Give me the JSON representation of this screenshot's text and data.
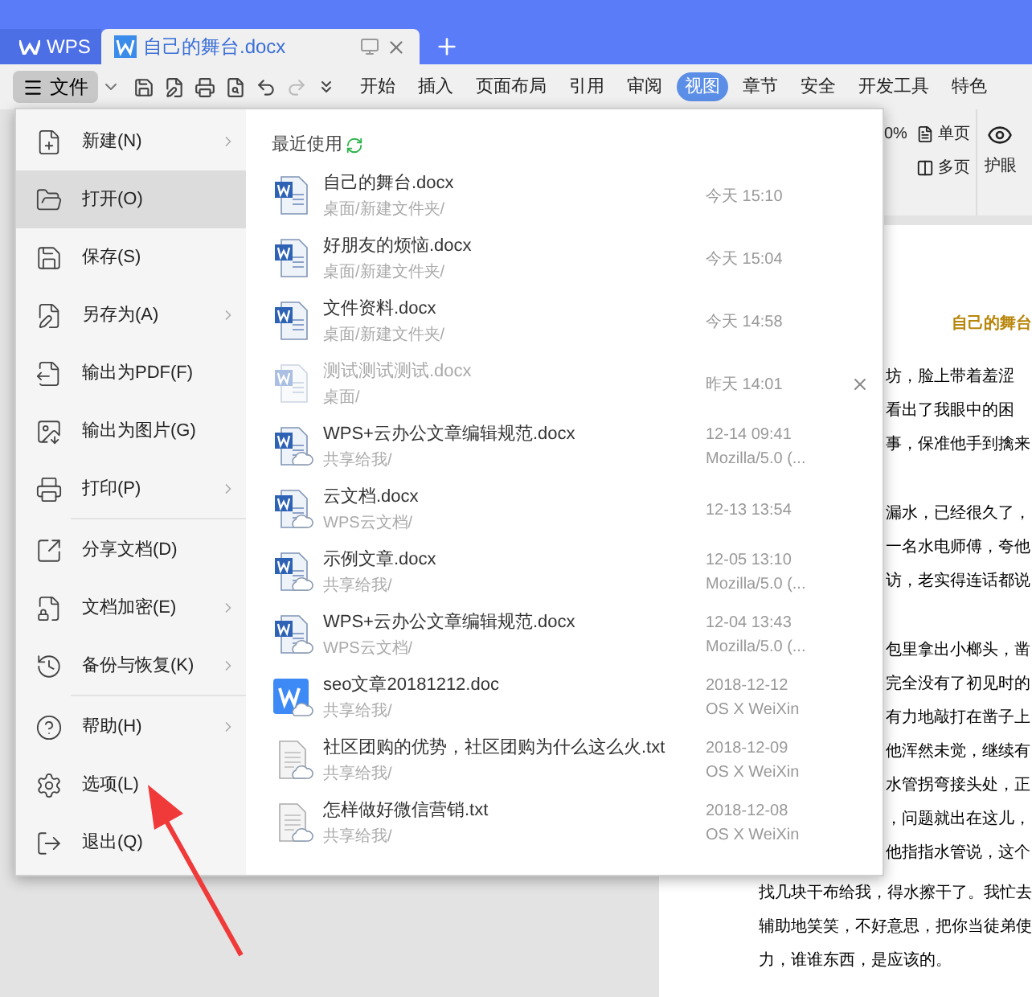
{
  "title_bar": {
    "app_tab": "WPS",
    "doc_tab": "自己的舞台.docx"
  },
  "toolbar": {
    "file_menu": "文件",
    "tabs": [
      {
        "label": "开始",
        "selected": false
      },
      {
        "label": "插入",
        "selected": false
      },
      {
        "label": "页面布局",
        "selected": false
      },
      {
        "label": "引用",
        "selected": false
      },
      {
        "label": "审阅",
        "selected": false
      },
      {
        "label": "视图",
        "selected": true
      },
      {
        "label": "章节",
        "selected": false
      },
      {
        "label": "安全",
        "selected": false
      },
      {
        "label": "开发工具",
        "selected": false
      },
      {
        "label": "特色",
        "selected": false
      }
    ]
  },
  "ribbon": {
    "zoom": "0%",
    "single_page": "单页",
    "multi_page": "多页",
    "eye_mode": "护眼"
  },
  "file_menu": {
    "groups": [
      [
        {
          "label": "新建(N)",
          "submenu": true,
          "selected": false
        },
        {
          "label": "打开(O)",
          "submenu": false,
          "selected": true
        },
        {
          "label": "保存(S)",
          "submenu": false,
          "selected": false
        },
        {
          "label": "另存为(A)",
          "submenu": true,
          "selected": false
        },
        {
          "label": "输出为PDF(F)",
          "submenu": false,
          "selected": false
        },
        {
          "label": "输出为图片(G)",
          "submenu": false,
          "selected": false
        },
        {
          "label": "打印(P)",
          "submenu": true,
          "selected": false
        }
      ],
      [
        {
          "label": "分享文档(D)",
          "submenu": false,
          "selected": false
        },
        {
          "label": "文档加密(E)",
          "submenu": true,
          "selected": false
        },
        {
          "label": "备份与恢复(K)",
          "submenu": true,
          "selected": false
        }
      ],
      [
        {
          "label": "帮助(H)",
          "submenu": true,
          "selected": false
        },
        {
          "label": "选项(L)",
          "submenu": false,
          "selected": false
        },
        {
          "label": "退出(Q)",
          "submenu": false,
          "selected": false
        }
      ]
    ]
  },
  "recent": {
    "heading": "最近使用",
    "files": [
      {
        "kind": "word",
        "name": "自己的舞台.docx",
        "path": "桌面/新建文件夹/",
        "time": "今天 15:10",
        "unavailable": false,
        "removable": false
      },
      {
        "kind": "word",
        "name": "好朋友的烦恼.docx",
        "path": "桌面/新建文件夹/",
        "time": "今天 15:04",
        "unavailable": false,
        "removable": false
      },
      {
        "kind": "word",
        "name": "文件资料.docx",
        "path": "桌面/新建文件夹/",
        "time": "今天 14:58",
        "unavailable": false,
        "removable": false
      },
      {
        "kind": "word",
        "name": "测试测试测试.docx",
        "path": "桌面/",
        "time": "昨天 14:01",
        "unavailable": true,
        "removable": true
      },
      {
        "kind": "word-cloud",
        "name": "WPS+云办公文章编辑规范.docx",
        "path": "共享给我/",
        "time": "12-14 09:41",
        "source": "Mozilla/5.0 (...",
        "unavailable": false,
        "removable": false
      },
      {
        "kind": "word-cloud",
        "name": "云文档.docx",
        "path": "WPS云文档/",
        "time": "12-13 13:54",
        "unavailable": false,
        "removable": false
      },
      {
        "kind": "word-cloud",
        "name": "示例文章.docx",
        "path": "共享给我/",
        "time": "12-05 13:10",
        "source": "Mozilla/5.0 (...",
        "unavailable": false,
        "removable": false
      },
      {
        "kind": "word-cloud",
        "name": "WPS+云办公文章编辑规范.docx",
        "path": "WPS云文档/",
        "time": "12-04 13:43",
        "source": "Mozilla/5.0 (...",
        "unavailable": false,
        "removable": false
      },
      {
        "kind": "wps-cloud",
        "name": "seo文章20181212.doc",
        "path": "共享给我/",
        "time": "2018-12-12",
        "source": "OS X WeiXin",
        "unavailable": false,
        "removable": false
      },
      {
        "kind": "text-cloud",
        "name": "社区团购的优势，社区团购为什么这么火.txt",
        "path": "共享给我/",
        "time": "2018-12-09",
        "source": "OS X WeiXin",
        "unavailable": false,
        "removable": false
      },
      {
        "kind": "text-cloud",
        "name": "怎样做好微信营销.txt",
        "path": "共享给我/",
        "time": "2018-12-08",
        "source": "OS X WeiXin",
        "unavailable": false,
        "removable": false
      }
    ]
  },
  "document": {
    "title": "自己的舞台",
    "paragraphs_beside_menu": [
      [
        "坊，脸上带着羞涩",
        "看出了我眼中的困",
        "事，保准他手到擒来"
      ],
      [
        "漏水，已经很久了，",
        "一名水电师傅，夸他",
        "访，老实得连话都说"
      ],
      [
        "包里拿出小榔头，凿",
        "完全没有了初见时的",
        "有力地敲打在凿子上",
        "他浑然未觉，继续有",
        "水管拐弯接头处，正",
        "，问题就出在这儿，",
        "他指指水管说，这个"
      ]
    ],
    "lines_below_menu": [
      "找几块干布给我，得水擦干了。我忙去",
      "辅助地笑笑，不好意思，把你当徒弟使",
      "力，谁谁东西，是应该的。"
    ]
  }
}
